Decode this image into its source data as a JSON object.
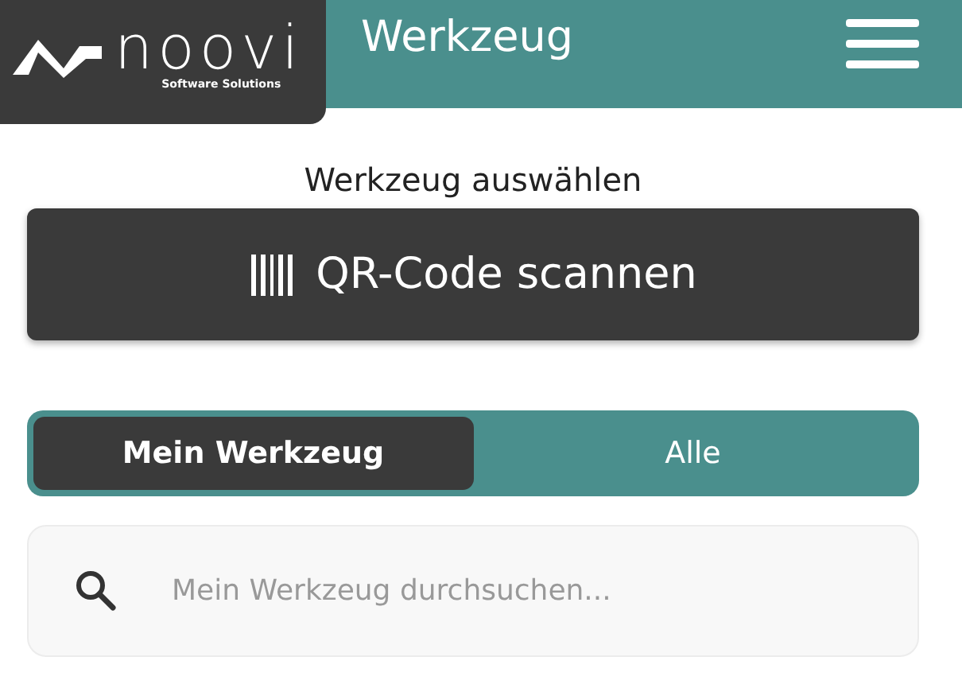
{
  "header": {
    "logo": {
      "name": "noovi",
      "tagline": "Software Solutions"
    },
    "title": "Werkzeug"
  },
  "section_label": "Werkzeug auswählen",
  "scan_button": {
    "label": "QR-Code scannen"
  },
  "segments": [
    {
      "label": "Mein Werkzeug",
      "selected": true
    },
    {
      "label": "Alle",
      "selected": false
    }
  ],
  "search": {
    "placeholder": "Mein Werkzeug durchsuchen..."
  }
}
